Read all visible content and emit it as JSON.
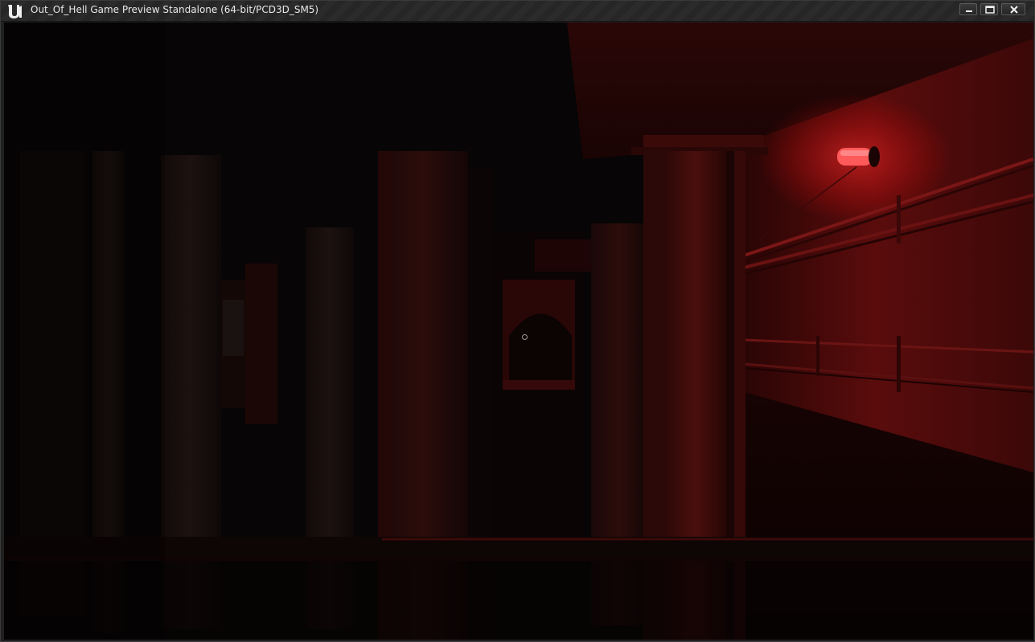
{
  "window": {
    "title": "Out_Of_Hell Game Preview Standalone (64-bit/PCD3D_SM5)",
    "logo_icon": "unreal-engine-logo-icon",
    "controls": {
      "minimize_icon": "minimize-icon",
      "maximize_icon": "maximize-icon",
      "close_icon": "close-icon"
    }
  },
  "viewport": {
    "scene": "dark-red-lit-corridor",
    "crosshair_icon": "crosshair-icon",
    "colors": {
      "ambient_dark": "#080606",
      "wall_red": "#5a0d0d",
      "lamp_red": "#ff5a5a"
    }
  }
}
